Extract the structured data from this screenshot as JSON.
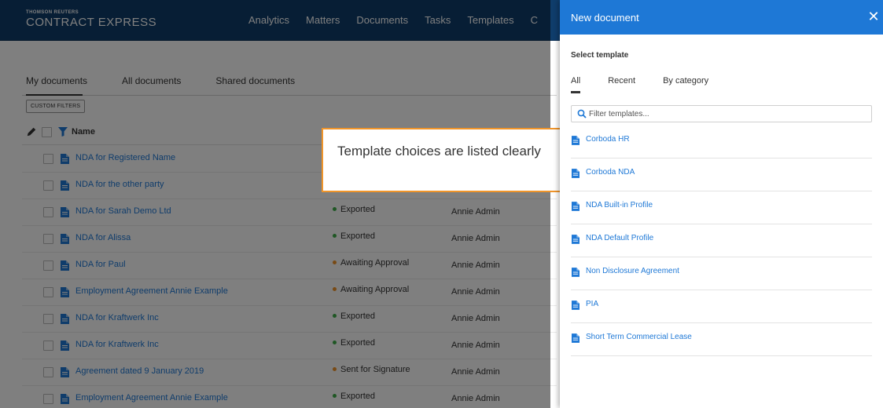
{
  "header": {
    "brand_small": "THOMSON REUTERS",
    "brand_big": "CONTRACT EXPRESS",
    "nav": [
      "Analytics",
      "Matters",
      "Documents",
      "Tasks",
      "Templates",
      "C"
    ]
  },
  "doc_tabs": [
    "My documents",
    "All documents",
    "Shared documents"
  ],
  "custom_filters_label": "CUSTOM FILTERS",
  "list_header": {
    "name": "Name"
  },
  "rows": [
    {
      "name": "NDA for Registered Name",
      "status": "",
      "owner": "",
      "dot": ""
    },
    {
      "name": "NDA for the other party",
      "status": "",
      "owner": "",
      "dot": ""
    },
    {
      "name": "NDA for Sarah Demo Ltd",
      "status": "Exported",
      "owner": "Annie Admin",
      "dot": "#3fae49"
    },
    {
      "name": "NDA for Alissa",
      "status": "Exported",
      "owner": "Annie Admin",
      "dot": "#3fae49"
    },
    {
      "name": "NDA for Paul",
      "status": "Awaiting Approval",
      "owner": "Annie Admin",
      "dot": "#f0952a"
    },
    {
      "name": "Employment Agreement Annie Example",
      "status": "Awaiting Approval",
      "owner": "Annie Admin",
      "dot": "#f0952a"
    },
    {
      "name": "NDA for Kraftwerk Inc",
      "status": "Exported",
      "owner": "Annie Admin",
      "dot": "#3fae49"
    },
    {
      "name": "NDA for Kraftwerk Inc",
      "status": "Exported",
      "owner": "Annie Admin",
      "dot": "#3fae49"
    },
    {
      "name": "Agreement dated 9 January 2019",
      "status": "Sent for Signature",
      "owner": "Annie Admin",
      "dot": "#f0952a"
    },
    {
      "name": "Employment Agreement Annie Example",
      "status": "Exported",
      "owner": "Annie Admin",
      "dot": "#3fae49"
    }
  ],
  "callout": {
    "text": "Template choices are listed clearly",
    "border_color": "#f0952a"
  },
  "panel": {
    "title": "New document",
    "close_glyph": "✕",
    "select_label": "Select template",
    "tabs": [
      "All",
      "Recent",
      "By category"
    ],
    "filter_placeholder": "Filter templates...",
    "templates": [
      "Corboda HR",
      "Corboda NDA",
      "NDA Built-in Profile",
      "NDA Default Profile",
      "Non Disclosure Agreement",
      "PIA",
      "Short Term Commercial Lease"
    ]
  },
  "colors": {
    "header_bg": "#0f3d6b",
    "accent": "#1e78d6",
    "exported": "#3fae49",
    "pending": "#f0952a"
  },
  "icons": [
    "pencil-icon",
    "filter-funnel-icon",
    "document-icon",
    "search-icon",
    "close-icon"
  ]
}
